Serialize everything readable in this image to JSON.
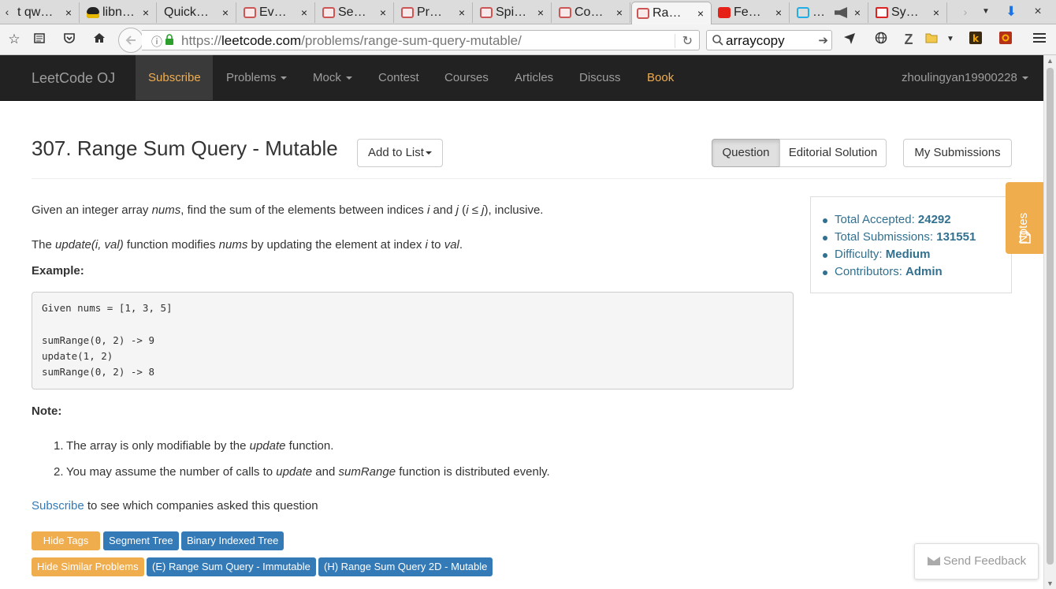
{
  "browser": {
    "tabs": [
      {
        "title": "t qw…",
        "icon": "generic"
      },
      {
        "title": "libn…",
        "icon": "tux"
      },
      {
        "title": "Quick…",
        "icon": "generic"
      },
      {
        "title": "Ev…",
        "icon": "leetcode"
      },
      {
        "title": "Se…",
        "icon": "leetcode"
      },
      {
        "title": "Pr…",
        "icon": "leetcode"
      },
      {
        "title": "Spi…",
        "icon": "leetcode"
      },
      {
        "title": "Co…",
        "icon": "leetcode"
      },
      {
        "title": "Ra…",
        "icon": "leetcode"
      },
      {
        "title": "Fe…",
        "icon": "youtube"
      },
      {
        "title": "…",
        "icon": "bilibili"
      },
      {
        "title": "Sy…",
        "icon": "sy"
      }
    ],
    "close_glyph": "×",
    "url": {
      "prefix": "https://",
      "domain": "leetcode.com",
      "path": "/problems/range-sum-query-mutable/"
    },
    "search_value": "arraycopy"
  },
  "lc_nav": {
    "brand": "LeetCode OJ",
    "subscribe": "Subscribe",
    "problems": "Problems",
    "mock": "Mock",
    "contest": "Contest",
    "courses": "Courses",
    "articles": "Articles",
    "discuss": "Discuss",
    "book": "Book",
    "user": "zhoulingyan19900228"
  },
  "header": {
    "title": "307. Range Sum Query - Mutable",
    "add_to_list": "Add to List",
    "question": "Question",
    "editorial": "Editorial Solution",
    "my_submissions": "My Submissions"
  },
  "body": {
    "p1": {
      "a": "Given an integer array ",
      "b": "nums",
      "c": ", find the sum of the elements between indices ",
      "d": "i",
      "e": " and ",
      "f": "j",
      "g": " (",
      "h": "i",
      "k": " ≤ ",
      "l": "j",
      "m": "), inclusive."
    },
    "p2": {
      "a": "The ",
      "b": "update(i, val)",
      "c": " function modifies ",
      "d": "nums",
      "e": " by updating the element at index ",
      "f": "i",
      "g": " to ",
      "h": "val",
      "k": "."
    },
    "example_label": "Example:",
    "code": "Given nums = [1, 3, 5]\n\nsumRange(0, 2) -> 9\nupdate(1, 2)\nsumRange(0, 2) -> 8",
    "note_label": "Note:",
    "note1": {
      "num": "1.",
      "a": "The array is only modifiable by the ",
      "b": "update",
      "c": " function."
    },
    "note2": {
      "num": "2.",
      "a": "You may assume the number of calls to ",
      "b": "update",
      "c": " and ",
      "d": "sumRange",
      "e": " function is distributed evenly."
    },
    "subscribe_link": "Subscribe",
    "subscribe_rest": " to see which companies asked this question"
  },
  "tags": {
    "hide_tags": "Hide Tags",
    "tag1": "Segment Tree",
    "tag2": "Binary Indexed Tree",
    "hide_similar": "Hide Similar Problems",
    "sim1": "(E) Range Sum Query - Immutable",
    "sim2": "(H) Range Sum Query 2D - Mutable"
  },
  "stats": {
    "accepted_label": "Total Accepted: ",
    "accepted": "24292",
    "submissions_label": "Total Submissions: ",
    "submissions": "131551",
    "difficulty_label": "Difficulty: ",
    "difficulty": "Medium",
    "contributors_label": "Contributors: ",
    "contributors": "Admin"
  },
  "notes_tab": "Notes",
  "feedback": "Send Feedback",
  "colors": {
    "accent_orange": "#f0ad4e",
    "primary_blue": "#337ab7",
    "info_text": "#31708f",
    "nav_bg": "#222222"
  }
}
